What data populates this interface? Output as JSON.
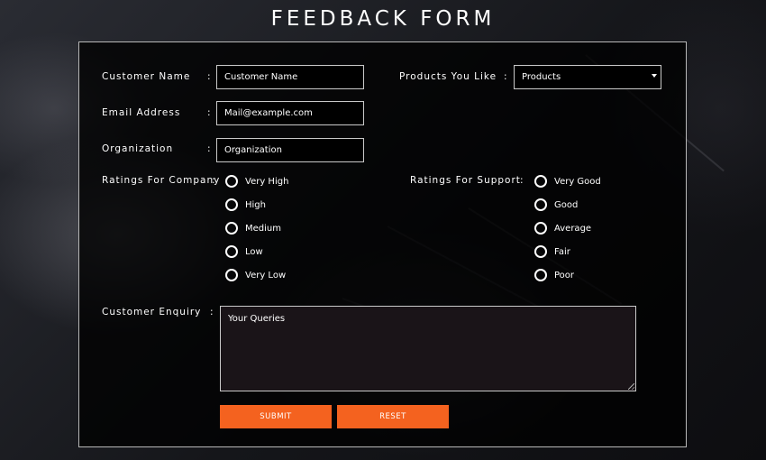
{
  "page": {
    "title": "FEEDBACK FORM"
  },
  "form": {
    "customer_name": {
      "label": "Customer Name",
      "colon": ":",
      "value": "Customer Name"
    },
    "email": {
      "label": "Email Address",
      "colon": ":",
      "value": "Mail@example.com"
    },
    "organization": {
      "label": "Organization",
      "colon": ":",
      "value": "Organization"
    },
    "products": {
      "label": "Products You Like",
      "colon": ":",
      "selected": "Products"
    },
    "company_rating": {
      "label": "Ratings For Company",
      "colon": ":",
      "options": [
        "Very High",
        "High",
        "Medium",
        "Low",
        "Very Low"
      ]
    },
    "support_rating": {
      "label": "Ratings For Support",
      "colon": ":",
      "options": [
        "Very Good",
        "Good",
        "Average",
        "Fair",
        "Poor"
      ]
    },
    "enquiry": {
      "label": "Customer Enquiry",
      "colon": ":",
      "value": "Your Queries"
    },
    "buttons": {
      "submit": "SUBMIT",
      "reset": "RESET"
    }
  },
  "colors": {
    "accent": "#f4621f",
    "panel": "#000000",
    "border": "#c9c9c9",
    "text": "#ffffff"
  }
}
